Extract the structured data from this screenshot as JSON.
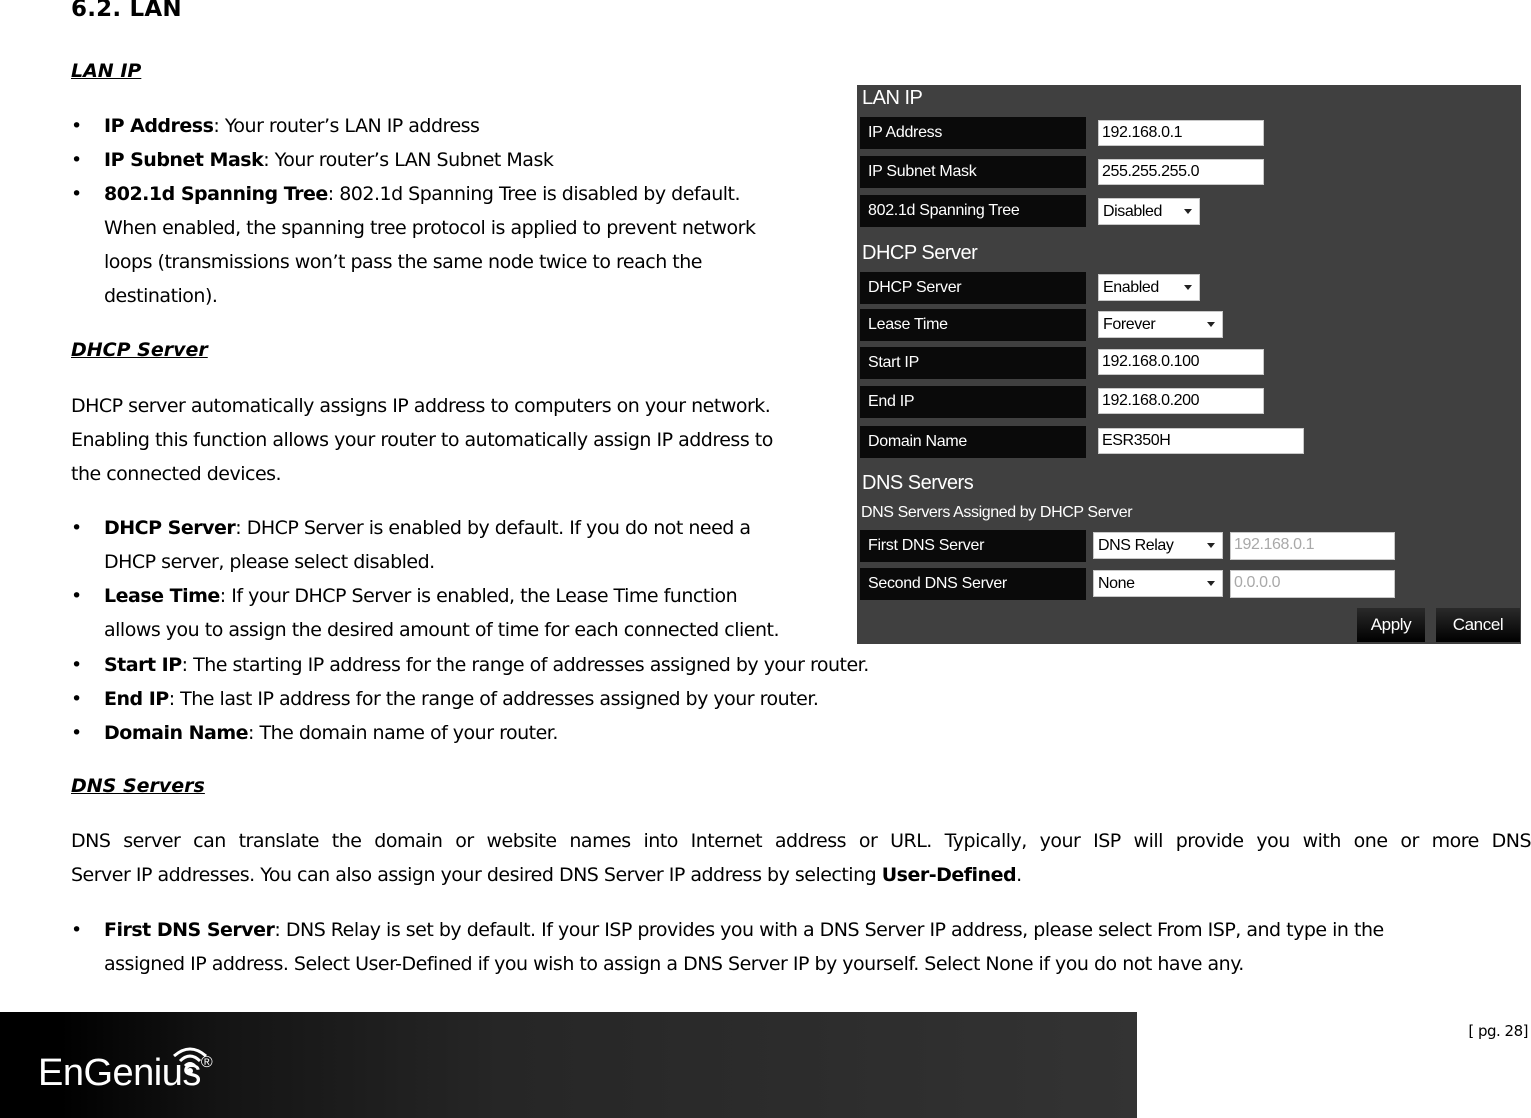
{
  "section_title": "6.2.  LAN",
  "lan_ip": {
    "heading": "LAN IP",
    "bullets": [
      {
        "term": "IP Address",
        "text": ": Your router’s LAN IP address"
      },
      {
        "term": "IP Subnet Mask",
        "text": ": Your router’s LAN Subnet Mask"
      },
      {
        "term": "802.1d Spanning Tree",
        "text": ":  802.1d Spanning Tree is disabled by default.",
        "cont": [
          "When enabled, the spanning tree protocol is applied to prevent network",
          "loops (transmissions won’t pass the same node twice to reach the",
          "destination)."
        ]
      }
    ]
  },
  "dhcp": {
    "heading": "DHCP Server",
    "para": [
      "DHCP server automatically assigns IP address to computers on your network.",
      "Enabling this function allows your router to automatically assign IP address to",
      "the connected devices."
    ],
    "bullets": [
      {
        "term": "DHCP Server",
        "text": ": DHCP Server is enabled by default. If you do not need a",
        "cont": [
          "DHCP server, please select disabled."
        ]
      },
      {
        "term": "Lease Time",
        "text": ": If your DHCP Server is enabled, the Lease Time function",
        "cont": [
          "allows you to assign the desired amount of time for each connected client."
        ]
      },
      {
        "term": "Start IP",
        "text": ": The starting IP address for the range of addresses assigned by your router."
      },
      {
        "term": "End IP",
        "text": ": The last IP address for the range of addresses assigned by your router."
      },
      {
        "term": "Domain Name",
        "text": ": The domain name of your router."
      }
    ]
  },
  "dns": {
    "heading": "DNS Servers",
    "para_line1": "DNS server can translate the domain or website names into Internet address or URL. Typically, your ISP will provide you with one or more DNS",
    "para_line2_pre": "Server IP addresses. You can also assign your desired DNS Server IP address by selecting ",
    "para_line2_bold": "User-Defined",
    "para_line2_post": ".",
    "bullets": [
      {
        "term": "First DNS Server",
        "text": ": DNS Relay is set by default. If your ISP provides you with a DNS Server IP address, please select From ISP, and type in the",
        "cont": [
          "assigned IP address. Select User-Defined if you wish to assign a DNS Server IP by yourself. Select None if you do not have any."
        ]
      }
    ]
  },
  "panel": {
    "lan_ip_title": "LAN IP",
    "ip_address_label": "IP Address",
    "ip_address_value": "192.168.0.1",
    "subnet_label": "IP Subnet Mask",
    "subnet_value": "255.255.255.0",
    "stp_label": "802.1d Spanning Tree",
    "stp_value": "Disabled",
    "dhcp_title": "DHCP Server",
    "dhcp_label": "DHCP Server",
    "dhcp_value": "Enabled",
    "lease_label": "Lease Time",
    "lease_value": "Forever",
    "start_label": "Start IP",
    "start_value": "192.168.0.100",
    "end_label": "End IP",
    "end_value": "192.168.0.200",
    "domain_label": "Domain Name",
    "domain_value": "ESR350H",
    "dns_title": "DNS Servers",
    "dns_subtitle": "DNS Servers Assigned by DHCP Server",
    "dns1_label": "First DNS Server",
    "dns1_mode": "DNS Relay",
    "dns1_value": "192.168.0.1",
    "dns2_label": "Second DNS Server",
    "dns2_mode": "None",
    "dns2_value": "0.0.0.0",
    "apply_label": "Apply",
    "cancel_label": "Cancel"
  },
  "footer": {
    "brand": "EnGenius",
    "registered": "®",
    "page": "[ pg. 28]"
  }
}
